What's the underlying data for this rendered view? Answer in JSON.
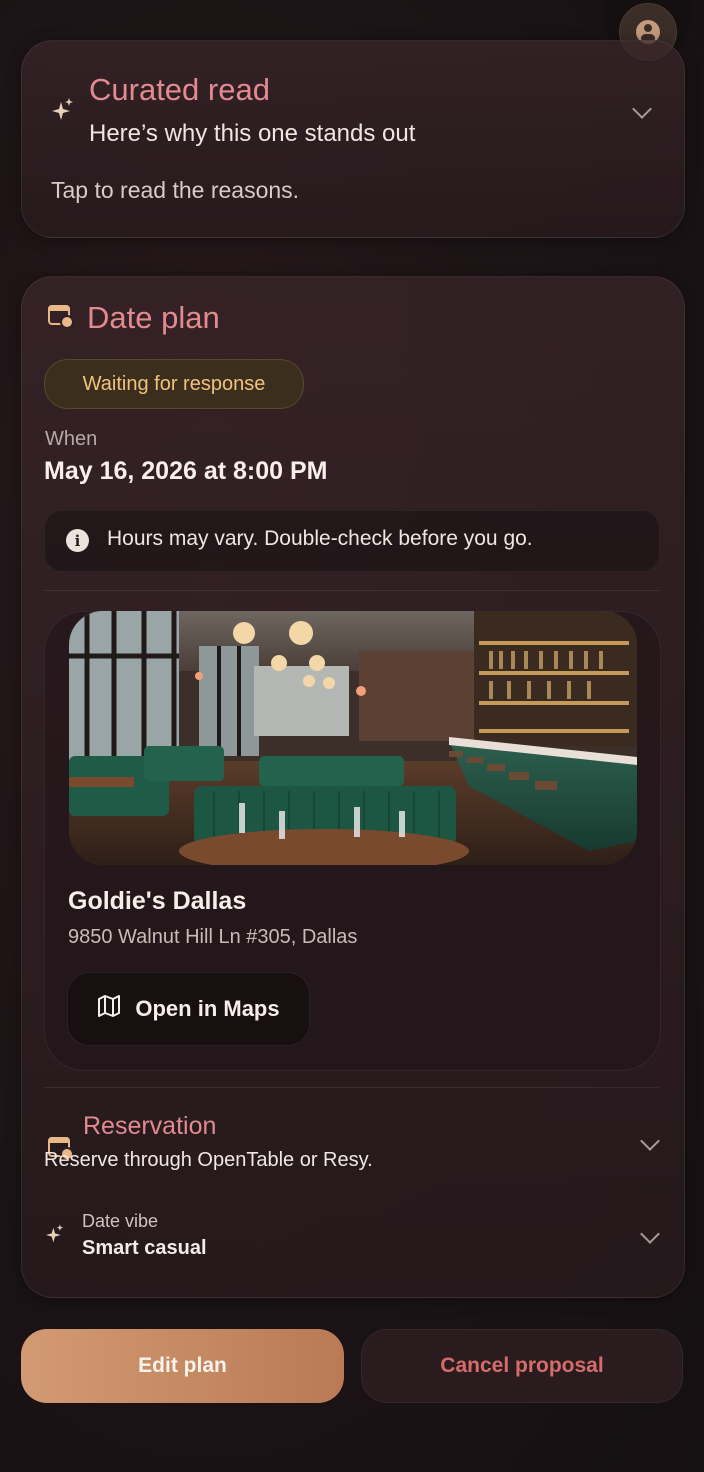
{
  "curated": {
    "title": "Curated read",
    "subtitle": "Here’s why this one stands out",
    "hint": "Tap to read the reasons."
  },
  "date_plan": {
    "title": "Date plan",
    "status_badge": "Waiting for response",
    "when_label": "When",
    "when_value": "May 16, 2026 at 8:00 PM",
    "notice": "Hours may vary. Double-check before you go.",
    "venue": {
      "name": "Goldie's Dallas",
      "address": "9850 Walnut Hill Ln #305,  Dallas",
      "maps_button": "Open in Maps"
    },
    "reservation": {
      "title": "Reservation",
      "subtitle": "Reserve through OpenTable or Resy."
    },
    "vibe": {
      "label": "Date vibe",
      "value": "Smart casual"
    }
  },
  "actions": {
    "edit": "Edit plan",
    "cancel": "Cancel proposal"
  },
  "colors": {
    "accent_pink": "#e38a90",
    "accent_gold": "#e9b889",
    "badge_text": "#f0c27c",
    "cancel_text": "#d66c6a",
    "edit_button": "#c9895f"
  },
  "icons": [
    "profile-icon",
    "sparkle-icon",
    "calendar-icon",
    "info-icon",
    "map-icon",
    "chevron-down-icon"
  ]
}
